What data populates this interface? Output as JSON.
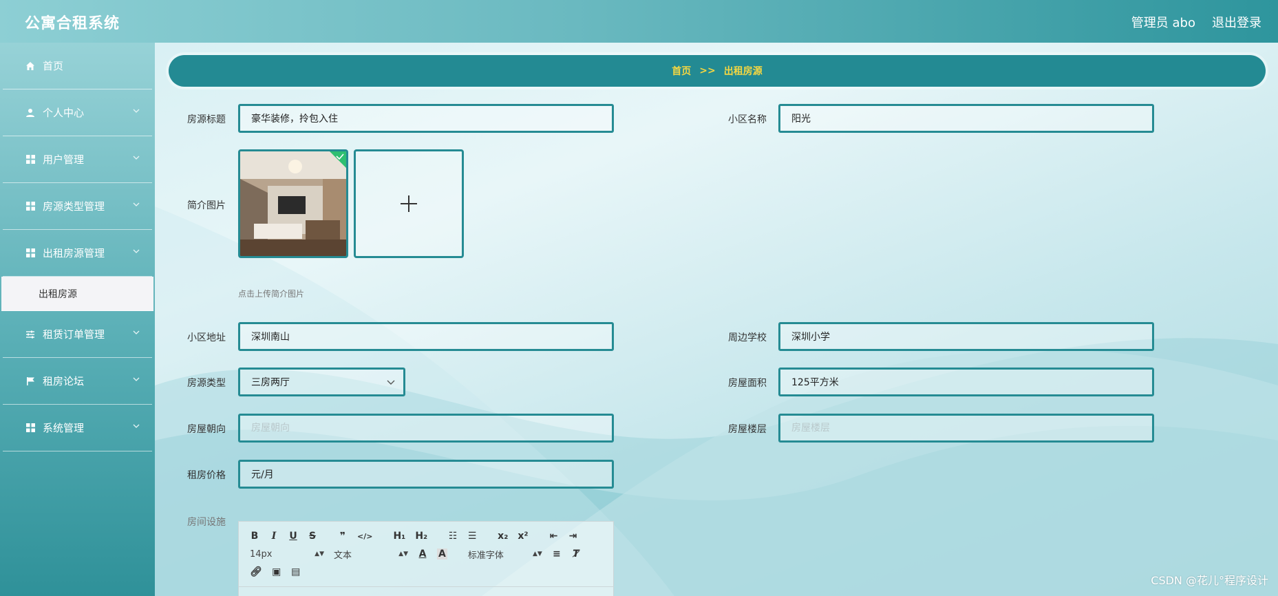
{
  "app": {
    "title": "公寓合租系统",
    "user_label": "管理员 abo",
    "logout_label": "退出登录"
  },
  "sidebar": {
    "items": [
      {
        "label": "首页",
        "icon": "home-icon"
      },
      {
        "label": "个人中心",
        "icon": "user-icon"
      },
      {
        "label": "用户管理",
        "icon": "grid-icon"
      },
      {
        "label": "房源类型管理",
        "icon": "grid-icon"
      },
      {
        "label": "出租房源管理",
        "icon": "grid-icon"
      },
      {
        "label": "租赁订单管理",
        "icon": "sliders-icon"
      },
      {
        "label": "租房论坛",
        "icon": "flag-icon"
      },
      {
        "label": "系统管理",
        "icon": "grid-icon"
      }
    ],
    "active_submenu": "出租房源"
  },
  "breadcrumb": {
    "home": "首页",
    "separator": ">>",
    "current": "出租房源"
  },
  "form": {
    "title_label": "房源标题",
    "title_value": "豪华装修，拎包入住",
    "community_label": "小区名称",
    "community_value": "阳光",
    "image_label": "简介图片",
    "image_tip": "点击上传简介图片",
    "address_label": "小区地址",
    "address_value": "深圳南山",
    "school_label": "周边学校",
    "school_value": "深圳小学",
    "type_label": "房源类型",
    "type_value": "三房两厅",
    "area_label": "房屋面积",
    "area_value": "125平方米",
    "orientation_label": "房屋朝向",
    "orientation_placeholder": "房屋朝向",
    "floor_label": "房屋楼层",
    "floor_placeholder": "房屋楼层",
    "price_label": "租房价格",
    "price_value": "元/月",
    "facilities_label": "房间设施"
  },
  "editor": {
    "font_size": "14px",
    "text_type": "文本",
    "font_family": "标准字体"
  },
  "watermark": "CSDN @花儿°程序设计",
  "colors": {
    "accent": "#258b93",
    "breadcrumb_text": "#f5d742"
  }
}
